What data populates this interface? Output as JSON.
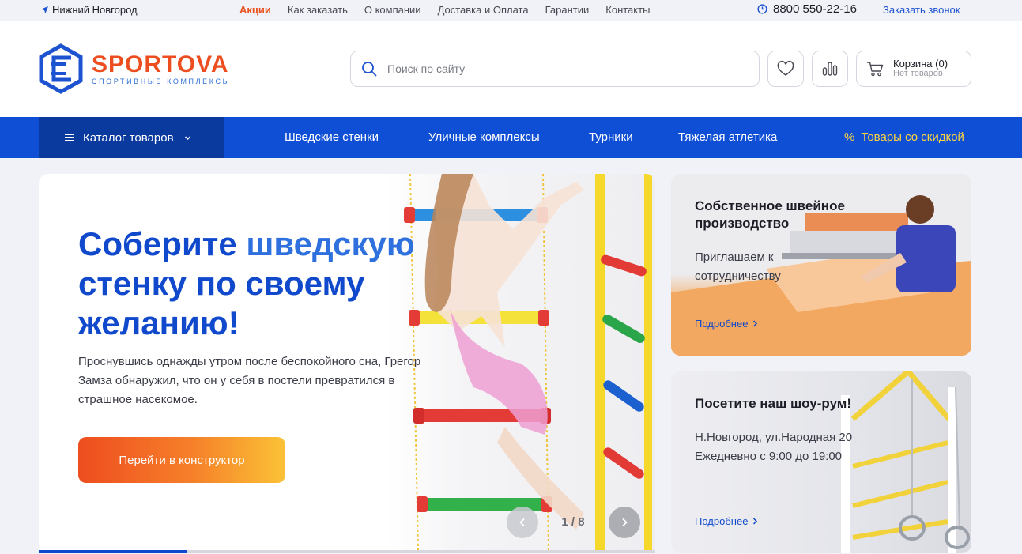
{
  "topbar": {
    "city": "Нижний Новгород",
    "nav": [
      "Акции",
      "Как заказать",
      "О компании",
      "Доставка и Оплата",
      "Гарантии",
      "Контакты"
    ],
    "phone": "8800 550-22-16",
    "callback": "Заказать звонок"
  },
  "header": {
    "logo_name": "SPORTOVA",
    "logo_sub": "СПОРТИВНЫЕ КОМПЛЕКСЫ",
    "search_placeholder": "Поиск по сайту",
    "cart_title": "Корзина (0)",
    "cart_sub": "Нет товаров"
  },
  "mainnav": {
    "catalog": "Каталог товаров",
    "items": [
      "Шведские стенки",
      "Уличные комплексы",
      "Турники",
      "Тяжелая атлетика"
    ],
    "discount_icon": "%",
    "discount": "Товары со скидкой"
  },
  "hero": {
    "title_a": "Соберите ",
    "title_b": "шведскую",
    "title_c": " стенку по своему желанию!",
    "text": "Проснувшись однажды утром после беспокойного сна, Грегор Замза обнаружил, что он у себя в постели превратился в страшное насекомое.",
    "cta": "Перейти в конструктор",
    "counter": "1 / 8",
    "progress": 0.24
  },
  "cards": [
    {
      "title": "Собственное швейное производство",
      "text": "Приглашаем к сотрудничеству",
      "more": "Подробнее"
    },
    {
      "title": "Посетите наш шоу-рум!",
      "text_line1": "Н.Новгород, ул.Народная 20",
      "text_line2": "Ежедневно с 9:00 до 19:00",
      "more": "Подробнее"
    }
  ],
  "colors": {
    "brand_blue": "#0f4fd6",
    "brand_orange": "#ec4e20",
    "discount_yellow": "#ffd53e"
  },
  "icons": {
    "city": "location-arrow-icon",
    "phone": "clock-icon",
    "search": "search-icon",
    "fav": "heart-icon",
    "compare": "bars-chart-icon",
    "cart": "cart-icon"
  }
}
